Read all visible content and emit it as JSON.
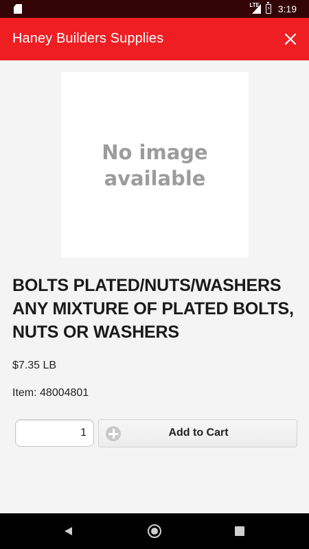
{
  "status_bar": {
    "network": "LTE",
    "time": "3:19",
    "icons": [
      "sd-card-icon",
      "signal-icon",
      "battery-charging-icon"
    ]
  },
  "app_bar": {
    "title": "Haney Builders Supplies",
    "close_icon": "close-icon"
  },
  "product": {
    "image_placeholder": "No image available",
    "title": "BOLTS PLATED/NUTS/WASHERS ANY MIXTURE OF PLATED BOLTS, NUTS OR WASHERS",
    "price": "$7.35 LB",
    "item_label": "Item:",
    "item_number": "48004801"
  },
  "cart": {
    "quantity": "1",
    "add_label": "Add to Cart",
    "add_icon": "plus-circle-icon"
  },
  "nav_bar": {
    "icons": [
      "back-icon",
      "home-icon",
      "recents-icon"
    ]
  },
  "colors": {
    "app_bar": "#ef1e23",
    "status_bar": "#330405",
    "background": "#f4f4f4"
  }
}
